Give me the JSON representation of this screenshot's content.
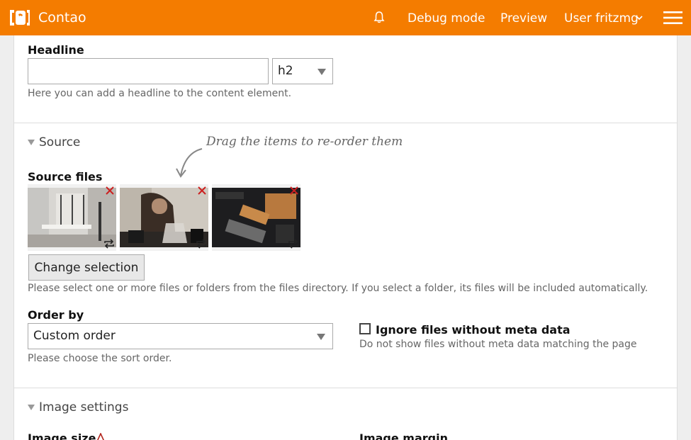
{
  "header": {
    "brand": "Contao",
    "nav_debug": "Debug mode",
    "nav_preview": "Preview",
    "nav_user": "User fritzmg",
    "icons": {
      "logo": "contao-logo-icon",
      "bell": "bell-icon",
      "chevron": "chevron-down-icon",
      "menu": "hamburger-menu-icon"
    }
  },
  "headline": {
    "label": "Headline",
    "value": "",
    "unit_value": "h2",
    "help": "Here you can add a headline to the content element."
  },
  "source": {
    "legend": "Source",
    "hint": "Drag the items to re-order them",
    "files_label": "Source files",
    "thumbnails": [
      {
        "name": "office-interior-image"
      },
      {
        "name": "coffee-brewing-image"
      },
      {
        "name": "leather-goods-flatlay-image"
      }
    ],
    "change_button": "Change selection",
    "files_help": "Please select one or more files or folders from the files directory. If you select a folder, its files will be included automatically.",
    "order_label": "Order by",
    "order_value": "Custom order",
    "order_help": "Please choose the sort order.",
    "ignore_label": "Ignore files without meta data",
    "ignore_help": "Do not show files without meta data matching the page",
    "ignore_checked": false
  },
  "image_settings": {
    "legend": "Image settings",
    "size_label": "Image size",
    "margin_label": "Image margin"
  },
  "colors": {
    "accent": "#f47c00",
    "remove": "#cc1f1f"
  }
}
